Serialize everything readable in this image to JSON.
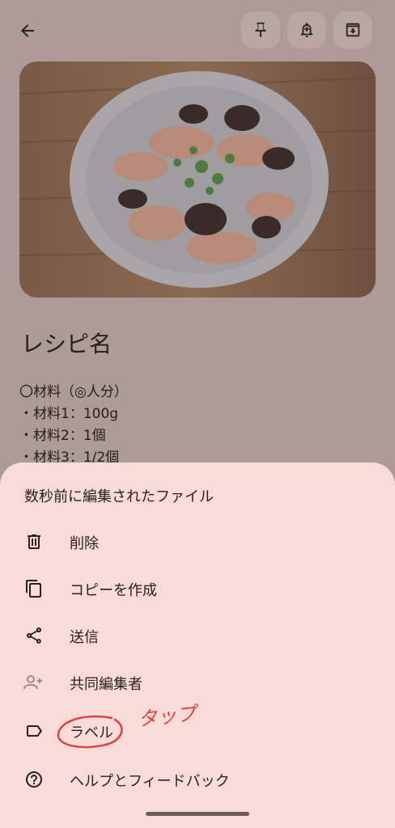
{
  "note": {
    "title": "レシピ名",
    "lines": [
      "〇材料（◎人分）",
      "・材料1：100g",
      "・材料2：1個",
      "・材料3：1/2個"
    ]
  },
  "sheet": {
    "title": "数秒前に編集されたファイル",
    "items": [
      {
        "label": "削除",
        "icon": "trash-icon"
      },
      {
        "label": "コピーを作成",
        "icon": "copy-icon"
      },
      {
        "label": "送信",
        "icon": "share-icon"
      },
      {
        "label": "共同編集者",
        "icon": "add-person-icon"
      },
      {
        "label": "ラベル",
        "icon": "label-icon"
      },
      {
        "label": "ヘルプとフィードバック",
        "icon": "help-icon"
      }
    ]
  },
  "annotation": {
    "text": "タップ",
    "color": "#e2423f"
  }
}
